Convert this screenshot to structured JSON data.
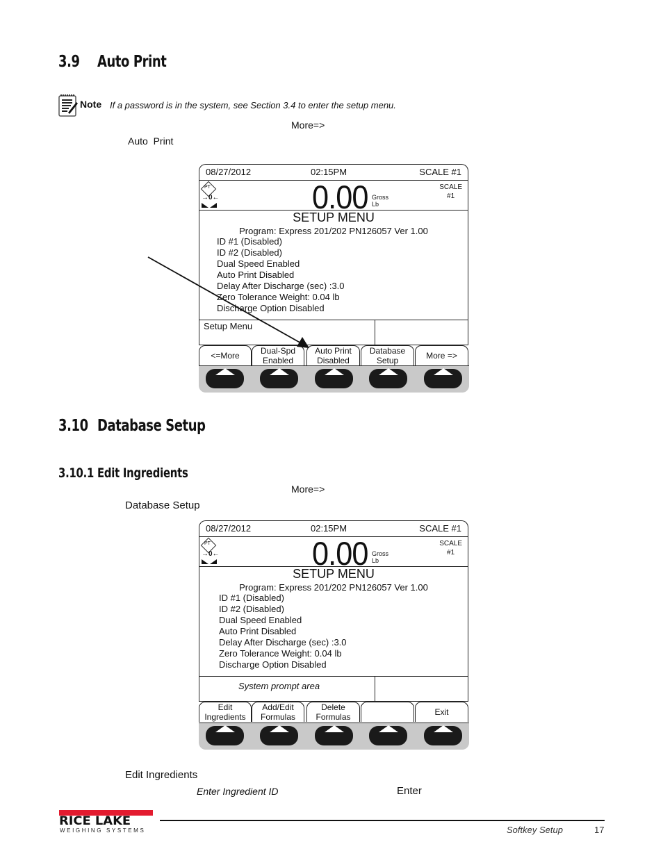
{
  "section_3_9": {
    "number": "3.9",
    "title": "Auto Print",
    "note_label": "Note",
    "note_text": "If a password is in the system, see Section 3.4 to enter the setup menu.",
    "fragment_more": "More=>",
    "fragment_softkey": "Auto  Print"
  },
  "screen1": {
    "date": "08/27/2012",
    "time": "02:15PM",
    "scale": "SCALE #1",
    "weight": "0.00",
    "mode": "Gross",
    "unit": "Lb",
    "scale_small_1": "SCALE",
    "scale_small_2": "#1",
    "pt_label": "PT",
    "zero_label": "→0←",
    "menu_title": "SETUP MENU",
    "program": "Program: Express 201/202 PN126057 Ver 1.00",
    "lines": [
      "ID #1 (Disabled)",
      "ID #2 (Disabled)",
      "Dual Speed Enabled",
      "Auto Print Disabled",
      "Delay After Discharge (sec) :3.0",
      "Zero Tolerance Weight: 0.04 lb",
      "Discharge Option Disabled"
    ],
    "prompt": "Setup Menu",
    "softkeys": [
      {
        "line1": "<=More",
        "line2": ""
      },
      {
        "line1": "Dual-Spd",
        "line2": "Enabled"
      },
      {
        "line1": "Auto Print",
        "line2": "Disabled"
      },
      {
        "line1": "Database",
        "line2": "Setup"
      },
      {
        "line1": "More =>",
        "line2": ""
      }
    ]
  },
  "section_3_10": {
    "number": "3.10",
    "title": "Database Setup"
  },
  "section_3_10_1": {
    "number": "3.10.1",
    "title": "Edit Ingredients",
    "fragment_more": "More=>",
    "fragment_softkey": "Database Setup"
  },
  "screen2": {
    "date": "08/27/2012",
    "time": "02:15PM",
    "scale": "SCALE #1",
    "weight": "0.00",
    "mode": "Gross",
    "unit": "Lb",
    "scale_small_1": "SCALE",
    "scale_small_2": "#1",
    "pt_label": "PT",
    "zero_label": "→0←",
    "menu_title": "SETUP MENU",
    "program": "Program: Express 201/202 PN126057 Ver 1.00",
    "lines": [
      "ID #1 (Disabled)",
      "ID #2 (Disabled)",
      "Dual Speed Enabled",
      "Auto Print Disabled",
      "Delay After Discharge (sec) :3.0",
      "Zero Tolerance Weight: 0.04 lb",
      "Discharge Option Disabled"
    ],
    "prompt": "System prompt area",
    "softkeys": [
      {
        "line1": "Edit",
        "line2": "Ingredients"
      },
      {
        "line1": "Add/Edit",
        "line2": "Formulas"
      },
      {
        "line1": "Delete",
        "line2": "Formulas"
      },
      {
        "line1": "",
        "line2": ""
      },
      {
        "line1": "Exit",
        "line2": ""
      }
    ]
  },
  "after_text": {
    "edit_ingredients": "Edit Ingredients",
    "enter_ingredient_id": "Enter Ingredient ID",
    "enter": "Enter"
  },
  "footer": {
    "logo": "RICE LAKE",
    "logo_sub": "WEIGHING SYSTEMS",
    "section": "Softkey Setup",
    "page": "17",
    "brand_color": "#e31b2f"
  }
}
